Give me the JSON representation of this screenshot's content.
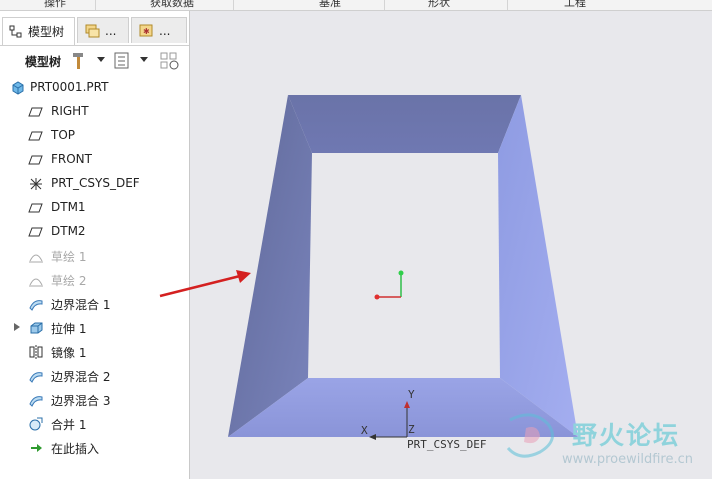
{
  "ribbon": {
    "groups": [
      "操作",
      "获取数据",
      "基准",
      "形状",
      "工程"
    ]
  },
  "panel": {
    "tab_model_tree": "模型树",
    "tab2_more": "...",
    "tab3_more": "...",
    "toolbar_label": "模型树"
  },
  "tree": {
    "root": "PRT0001.PRT",
    "items": [
      {
        "label": "RIGHT",
        "icon": "datum-plane-icon",
        "dim": false
      },
      {
        "label": "TOP",
        "icon": "datum-plane-icon",
        "dim": false
      },
      {
        "label": "FRONT",
        "icon": "datum-plane-icon",
        "dim": false
      },
      {
        "label": "PRT_CSYS_DEF",
        "icon": "coordinate-system-icon",
        "dim": false
      },
      {
        "label": "DTM1",
        "icon": "datum-plane-icon",
        "dim": false
      },
      {
        "label": "DTM2",
        "icon": "datum-plane-icon",
        "dim": false
      },
      {
        "label": "草绘 1",
        "icon": "sketch-icon",
        "dim": true
      },
      {
        "label": "草绘 2",
        "icon": "sketch-icon",
        "dim": true
      },
      {
        "label": "边界混合 1",
        "icon": "boundary-blend-icon",
        "dim": false
      },
      {
        "label": "拉伸 1",
        "icon": "extrude-icon",
        "dim": false
      },
      {
        "label": "镜像 1",
        "icon": "mirror-icon",
        "dim": false
      },
      {
        "label": "边界混合 2",
        "icon": "boundary-blend-icon",
        "dim": false
      },
      {
        "label": "边界混合 3",
        "icon": "boundary-blend-icon",
        "dim": false
      },
      {
        "label": "合并 1",
        "icon": "merge-icon",
        "dim": false
      },
      {
        "label": "在此插入",
        "icon": "insert-here-arrow-icon",
        "dim": false
      }
    ]
  },
  "viewport": {
    "csys_label": "PRT_CSYS_DEF",
    "axis_x": "X",
    "axis_y": "Y",
    "axis_z": "Z",
    "watermark_text": "野火论坛",
    "watermark_url": "www.proewildfire.cn"
  },
  "colors": {
    "annotation_arrow": "#d42020",
    "model_face": "#8892d0"
  }
}
